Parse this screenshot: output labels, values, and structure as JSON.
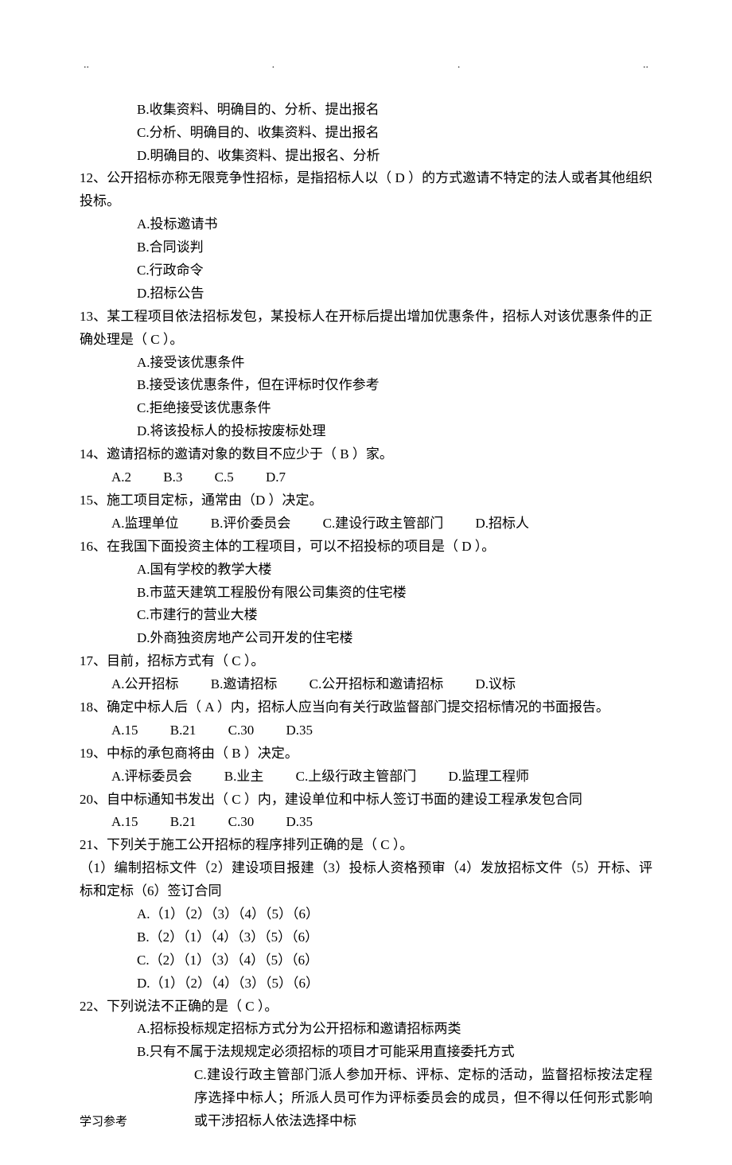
{
  "dots": {
    "d1": "..",
    "d2": ".",
    "d3": ".",
    "d4": ".."
  },
  "opt_b_top": "B.收集资料、明确目的、分析、提出报名",
  "opt_c_top": "C.分析、明确目的、收集资料、提出报名",
  "opt_d_top": "D.明确目的、收集资料、提出报名、分析",
  "q12": "12、公开招标亦称无限竞争性招标，是指招标人以（ D ）的方式邀请不特定的法人或者其他组织投标。",
  "q12a": "A.投标邀请书",
  "q12b": "B.合同谈判",
  "q12c": "C.行政命令",
  "q12d": "D.招标公告",
  "q13": "13、某工程项目依法招标发包，某投标人在开标后提出增加优惠条件，招标人对该优惠条件的正确处理是（ C ）。",
  "q13a": "A.接受该优惠条件",
  "q13b": "B.接受该优惠条件，但在评标时仅作参考",
  "q13c": "C.拒绝接受该优惠条件",
  "q13d": "D.将该投标人的投标按废标处理",
  "q14": "14、邀请招标的邀请对象的数目不应少于（ B ）家。",
  "q14a": "A.2",
  "q14b": "B.3",
  "q14c": "C.5",
  "q14d": "D.7",
  "q15": "15、施工项目定标，通常由（D  ）决定。",
  "q15a": "A.监理单位",
  "q15b": "B.评价委员会",
  "q15c": "C.建设行政主管部门",
  "q15d": "D.招标人",
  "q16": "16、在我国下面投资主体的工程项目，可以不招投标的项目是（ D ）。",
  "q16a": "A.国有学校的教学大楼",
  "q16b": "B.市蓝天建筑工程股份有限公司集资的住宅楼",
  "q16c": "C.市建行的营业大楼",
  "q16d": "D.外商独资房地产公司开发的住宅楼",
  "q17": "17、目前，招标方式有（ C ）。",
  "q17a": "A.公开招标",
  "q17b": "B.邀请招标",
  "q17c": "C.公开招标和邀请招标",
  "q17d": "D.议标",
  "q18": "18、确定中标人后（ A ）内，招标人应当向有关行政监督部门提交招标情况的书面报告。",
  "q18a": "A.15",
  "q18b": "B.21",
  "q18c": "C.30",
  "q18d": "D.35",
  "q19": "19、中标的承包商将由（ B ）决定。",
  "q19a": "A.评标委员会",
  "q19b": "B.业主",
  "q19c": "C.上级行政主管部门",
  "q19d": "D.监理工程师",
  "q20": "20、自中标通知书发出（ C ）内，建设单位和中标人签订书面的建设工程承发包合同",
  "q20a": "A.15",
  "q20b": "B.21",
  "q20c": "C.30",
  "q20d": "D.35",
  "q21": "21、下列关于施工公开招标的程序排列正确的是（ C ）。",
  "q21sub": "（1）编制招标文件（2）建设项目报建（3）投标人资格预审（4）发放招标文件（5）开标、评标和定标（6）签订合同",
  "q21a": "A.（1）（2）（3）（4）（5）（6）",
  "q21b": "B.（2）（1）（4）（3）（5）（6）",
  "q21c": "C.（2）（1）（3）（4）（5）（6）",
  "q21d": "D.（1）（2）（4）（3）（5）（6）",
  "q22": "22、下列说法不正确的是（ C ）。",
  "q22a": "A.招标投标规定招标方式分为公开招标和邀请招标两类",
  "q22b": "B.只有不属于法规规定必须招标的项目才可能采用直接委托方式",
  "q22c": "C.建设行政主管部门派人参加开标、评标、定标的活动，监督招标按法定程序选择中标人；所派人员可作为评标委员会的成员，但不得以任何形式影响或干涉招标人依法选择中标",
  "footer": "学习参考"
}
